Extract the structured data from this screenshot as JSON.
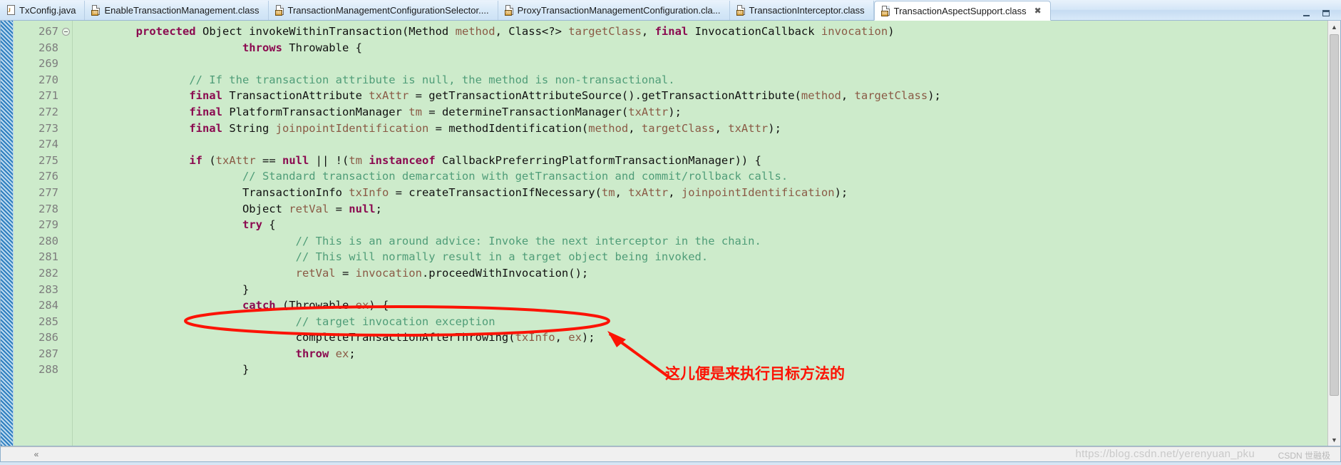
{
  "window": {
    "minimize_label": "minimize",
    "maximize_label": "maximize"
  },
  "tabs": [
    {
      "label": "TxConfig.java",
      "icon": "java-file-icon",
      "active": false,
      "closable": false
    },
    {
      "label": "EnableTransactionManagement.class",
      "icon": "class-file-icon",
      "active": false,
      "closable": false
    },
    {
      "label": "TransactionManagementConfigurationSelector....",
      "icon": "class-file-icon",
      "active": false,
      "closable": false
    },
    {
      "label": "ProxyTransactionManagementConfiguration.cla...",
      "icon": "class-file-icon",
      "active": false,
      "closable": false
    },
    {
      "label": "TransactionInterceptor.class",
      "icon": "class-file-icon",
      "active": false,
      "closable": false
    },
    {
      "label": "TransactionAspectSupport.class",
      "icon": "class-file-icon",
      "active": true,
      "closable": true,
      "close_glyph": "✖"
    }
  ],
  "editor": {
    "first_line": 267,
    "fold_marker_line": 267,
    "lines": [
      {
        "n": "267",
        "tokens": [
          {
            "t": "        ",
            "c": "pl"
          },
          {
            "t": "protected",
            "c": "kw"
          },
          {
            "t": " Object invokeWithinTransaction(Method ",
            "c": "pl"
          },
          {
            "t": "method",
            "c": "par"
          },
          {
            "t": ", Class<?> ",
            "c": "pl"
          },
          {
            "t": "targetClass",
            "c": "par"
          },
          {
            "t": ", ",
            "c": "pl"
          },
          {
            "t": "final",
            "c": "kw"
          },
          {
            "t": " InvocationCallback ",
            "c": "pl"
          },
          {
            "t": "invocation",
            "c": "par"
          },
          {
            "t": ")",
            "c": "pl"
          }
        ]
      },
      {
        "n": "268",
        "tokens": [
          {
            "t": "                        ",
            "c": "pl"
          },
          {
            "t": "throws",
            "c": "kw"
          },
          {
            "t": " Throwable {",
            "c": "pl"
          }
        ]
      },
      {
        "n": "269",
        "tokens": []
      },
      {
        "n": "270",
        "tokens": [
          {
            "t": "                ",
            "c": "pl"
          },
          {
            "t": "// If the transaction attribute is null, the method is non-transactional.",
            "c": "cm"
          }
        ]
      },
      {
        "n": "271",
        "tokens": [
          {
            "t": "                ",
            "c": "pl"
          },
          {
            "t": "final",
            "c": "kw"
          },
          {
            "t": " TransactionAttribute ",
            "c": "pl"
          },
          {
            "t": "txAttr",
            "c": "par"
          },
          {
            "t": " = getTransactionAttributeSource().getTransactionAttribute(",
            "c": "pl"
          },
          {
            "t": "method",
            "c": "par"
          },
          {
            "t": ", ",
            "c": "pl"
          },
          {
            "t": "targetClass",
            "c": "par"
          },
          {
            "t": ");",
            "c": "pl"
          }
        ]
      },
      {
        "n": "272",
        "tokens": [
          {
            "t": "                ",
            "c": "pl"
          },
          {
            "t": "final",
            "c": "kw"
          },
          {
            "t": " PlatformTransactionManager ",
            "c": "pl"
          },
          {
            "t": "tm",
            "c": "par"
          },
          {
            "t": " = determineTransactionManager(",
            "c": "pl"
          },
          {
            "t": "txAttr",
            "c": "par"
          },
          {
            "t": ");",
            "c": "pl"
          }
        ]
      },
      {
        "n": "273",
        "tokens": [
          {
            "t": "                ",
            "c": "pl"
          },
          {
            "t": "final",
            "c": "kw"
          },
          {
            "t": " String ",
            "c": "pl"
          },
          {
            "t": "joinpointIdentification",
            "c": "par"
          },
          {
            "t": " = methodIdentification(",
            "c": "pl"
          },
          {
            "t": "method",
            "c": "par"
          },
          {
            "t": ", ",
            "c": "pl"
          },
          {
            "t": "targetClass",
            "c": "par"
          },
          {
            "t": ", ",
            "c": "pl"
          },
          {
            "t": "txAttr",
            "c": "par"
          },
          {
            "t": ");",
            "c": "pl"
          }
        ]
      },
      {
        "n": "274",
        "tokens": []
      },
      {
        "n": "275",
        "tokens": [
          {
            "t": "                ",
            "c": "pl"
          },
          {
            "t": "if",
            "c": "kw"
          },
          {
            "t": " (",
            "c": "pl"
          },
          {
            "t": "txAttr",
            "c": "par"
          },
          {
            "t": " == ",
            "c": "pl"
          },
          {
            "t": "null",
            "c": "kw"
          },
          {
            "t": " || !(",
            "c": "pl"
          },
          {
            "t": "tm",
            "c": "par"
          },
          {
            "t": " ",
            "c": "pl"
          },
          {
            "t": "instanceof",
            "c": "kw"
          },
          {
            "t": " CallbackPreferringPlatformTransactionManager)) {",
            "c": "pl"
          }
        ]
      },
      {
        "n": "276",
        "tokens": [
          {
            "t": "                        ",
            "c": "pl"
          },
          {
            "t": "// Standard transaction demarcation with getTransaction and commit/rollback calls.",
            "c": "cm"
          }
        ]
      },
      {
        "n": "277",
        "tokens": [
          {
            "t": "                        ",
            "c": "pl"
          },
          {
            "t": "TransactionInfo ",
            "c": "pl"
          },
          {
            "t": "txInfo",
            "c": "par"
          },
          {
            "t": " = createTransactionIfNecessary(",
            "c": "pl"
          },
          {
            "t": "tm",
            "c": "par"
          },
          {
            "t": ", ",
            "c": "pl"
          },
          {
            "t": "txAttr",
            "c": "par"
          },
          {
            "t": ", ",
            "c": "pl"
          },
          {
            "t": "joinpointIdentification",
            "c": "par"
          },
          {
            "t": ");",
            "c": "pl"
          }
        ]
      },
      {
        "n": "278",
        "tokens": [
          {
            "t": "                        Object ",
            "c": "pl"
          },
          {
            "t": "retVal",
            "c": "par"
          },
          {
            "t": " = ",
            "c": "pl"
          },
          {
            "t": "null",
            "c": "kw"
          },
          {
            "t": ";",
            "c": "pl"
          }
        ]
      },
      {
        "n": "279",
        "tokens": [
          {
            "t": "                        ",
            "c": "pl"
          },
          {
            "t": "try",
            "c": "kw"
          },
          {
            "t": " {",
            "c": "pl"
          }
        ]
      },
      {
        "n": "280",
        "tokens": [
          {
            "t": "                                ",
            "c": "pl"
          },
          {
            "t": "// This is an around advice: Invoke the next interceptor in the chain.",
            "c": "cm"
          }
        ]
      },
      {
        "n": "281",
        "tokens": [
          {
            "t": "                                ",
            "c": "pl"
          },
          {
            "t": "// This will normally result in a target object being invoked.",
            "c": "cm"
          }
        ]
      },
      {
        "n": "282",
        "tokens": [
          {
            "t": "                                ",
            "c": "pl"
          },
          {
            "t": "retVal",
            "c": "par"
          },
          {
            "t": " = ",
            "c": "pl"
          },
          {
            "t": "invocation",
            "c": "par"
          },
          {
            "t": ".proceedWithInvocation();",
            "c": "pl"
          }
        ]
      },
      {
        "n": "283",
        "tokens": [
          {
            "t": "                        }",
            "c": "pl"
          }
        ]
      },
      {
        "n": "284",
        "tokens": [
          {
            "t": "                        ",
            "c": "pl"
          },
          {
            "t": "catch",
            "c": "kw"
          },
          {
            "t": " (Throwable ",
            "c": "pl"
          },
          {
            "t": "ex",
            "c": "par"
          },
          {
            "t": ") {",
            "c": "pl"
          }
        ]
      },
      {
        "n": "285",
        "tokens": [
          {
            "t": "                                ",
            "c": "pl"
          },
          {
            "t": "// target invocation exception",
            "c": "cm"
          }
        ]
      },
      {
        "n": "286",
        "tokens": [
          {
            "t": "                                ",
            "c": "pl"
          },
          {
            "t": "completeTransactionAfterThrowing(",
            "c": "pl"
          },
          {
            "t": "txInfo",
            "c": "par"
          },
          {
            "t": ", ",
            "c": "pl"
          },
          {
            "t": "ex",
            "c": "par"
          },
          {
            "t": ");",
            "c": "pl"
          }
        ]
      },
      {
        "n": "287",
        "tokens": [
          {
            "t": "                                ",
            "c": "pl"
          },
          {
            "t": "throw",
            "c": "kw"
          },
          {
            "t": " ",
            "c": "pl"
          },
          {
            "t": "ex",
            "c": "par"
          },
          {
            "t": ";",
            "c": "pl"
          }
        ]
      },
      {
        "n": "288",
        "tokens": [
          {
            "t": "                        }",
            "c": "pl"
          }
        ]
      }
    ]
  },
  "annotations": {
    "highlight_color": "#fc1305",
    "ellipse_target_line": "282",
    "note_text": "这儿便是来执行目标方法的"
  },
  "scrollbars": {
    "up_glyph": "▲",
    "down_glyph": "▼",
    "left_glyph": "«"
  },
  "watermark": {
    "url": "https://blog.csdn.net/yerenyuan_pku",
    "brand": "CSDN 世融极"
  },
  "colors": {
    "editor_background": "#cdebcb",
    "keyword": "#8b0a50",
    "comment": "#4f9d78",
    "parameter": "#8a5a45",
    "plain": "#111111",
    "line_number": "#7d7d7d",
    "accent_red": "#fc1305"
  }
}
